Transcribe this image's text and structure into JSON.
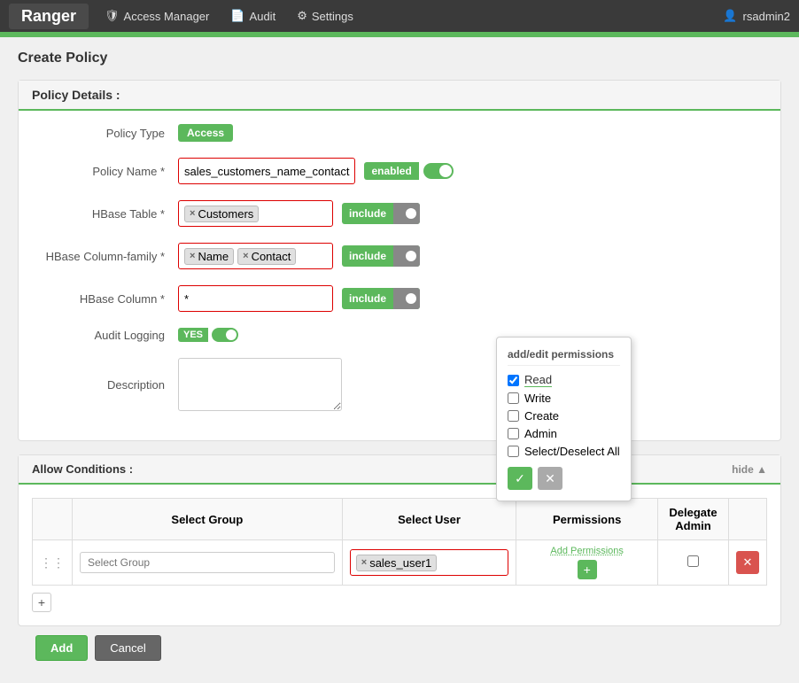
{
  "topnav": {
    "brand": "Ranger",
    "items": [
      {
        "label": "Access Manager",
        "icon": "shield-icon"
      },
      {
        "label": "Audit",
        "icon": "audit-icon"
      },
      {
        "label": "Settings",
        "icon": "settings-icon"
      }
    ],
    "user": "rsadmin2",
    "user_icon": "user-icon"
  },
  "page": {
    "title": "Create Policy"
  },
  "policy_details": {
    "section_label": "Policy Details :",
    "policy_type_label": "Policy Type",
    "policy_type_badge": "Access",
    "policy_name_label": "Policy Name *",
    "policy_name_value": "sales_customers_name_contact",
    "policy_name_toggle_label": "enabled",
    "hbase_table_label": "HBase Table *",
    "hbase_table_tag": "Customers",
    "hbase_table_include": "include",
    "hbase_column_family_label": "HBase Column-family *",
    "hbase_column_family_tags": [
      "Name",
      "Contact"
    ],
    "hbase_column_family_include": "include",
    "hbase_column_label": "HBase Column *",
    "hbase_column_value": "*",
    "hbase_column_include": "include",
    "audit_logging_label": "Audit Logging",
    "audit_logging_value": "YES",
    "description_label": "Description",
    "description_value": ""
  },
  "allow_conditions": {
    "section_label": "Allow Conditions :",
    "hide_label": "hide ▲",
    "table_headers": {
      "select_group": "Select Group",
      "select_user": "Select User",
      "permissions": "Permissions",
      "delegate_admin": "Delegate\nAdmin"
    },
    "rows": [
      {
        "select_group_placeholder": "Select Group",
        "select_user_tag": "sales_user1",
        "add_perms_label": "Add Permissions",
        "delegate_admin": false
      }
    ],
    "add_row_label": "+"
  },
  "permissions_popup": {
    "title": "add/edit permissions",
    "options": [
      {
        "label": "Read",
        "checked": true
      },
      {
        "label": "Write",
        "checked": false
      },
      {
        "label": "Create",
        "checked": false
      },
      {
        "label": "Admin",
        "checked": false
      },
      {
        "label": "Select/Deselect All",
        "checked": false
      }
    ],
    "ok_icon": "✓",
    "cancel_icon": "✕"
  },
  "footer": {
    "add_label": "Add",
    "cancel_label": "Cancel"
  }
}
